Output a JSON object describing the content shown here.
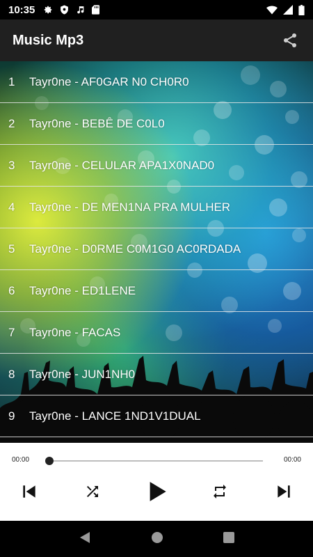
{
  "status_bar": {
    "time": "10:35",
    "icons_left": [
      "settings-icon",
      "shield-icon",
      "music-note-icon",
      "sd-card-icon"
    ],
    "icons_right": [
      "wifi-icon",
      "signal-icon",
      "battery-icon"
    ]
  },
  "app_bar": {
    "title": "Music Mp3",
    "share_icon": "share-icon"
  },
  "tracks": [
    {
      "num": "1",
      "title": "Tayr0ne - AF0GAR N0 CH0R0"
    },
    {
      "num": "2",
      "title": "Tayr0ne - BEBÊ DE C0L0"
    },
    {
      "num": "3",
      "title": "Tayr0ne - CELULAR APA1X0NAD0"
    },
    {
      "num": "4",
      "title": "Tayr0ne - DE MEN1NA PRA MULHER"
    },
    {
      "num": "5",
      "title": "Tayr0ne - D0RME C0M1G0 AC0RDADA"
    },
    {
      "num": "6",
      "title": "Tayr0ne - ED1LENE"
    },
    {
      "num": "7",
      "title": "Tayr0ne - FACAS"
    },
    {
      "num": "8",
      "title": "Tayr0ne - JUN1NH0"
    },
    {
      "num": "9",
      "title": "Tayr0ne - LANCE 1ND1V1DUAL"
    }
  ],
  "player": {
    "current_time": "00:00",
    "total_time": "00:00",
    "progress": 0,
    "controls": [
      "skip-previous-icon",
      "shuffle-icon",
      "play-icon",
      "repeat-icon",
      "skip-next-icon"
    ]
  },
  "nav_bar": {
    "buttons": [
      "back-icon",
      "home-icon",
      "recents-icon"
    ]
  }
}
